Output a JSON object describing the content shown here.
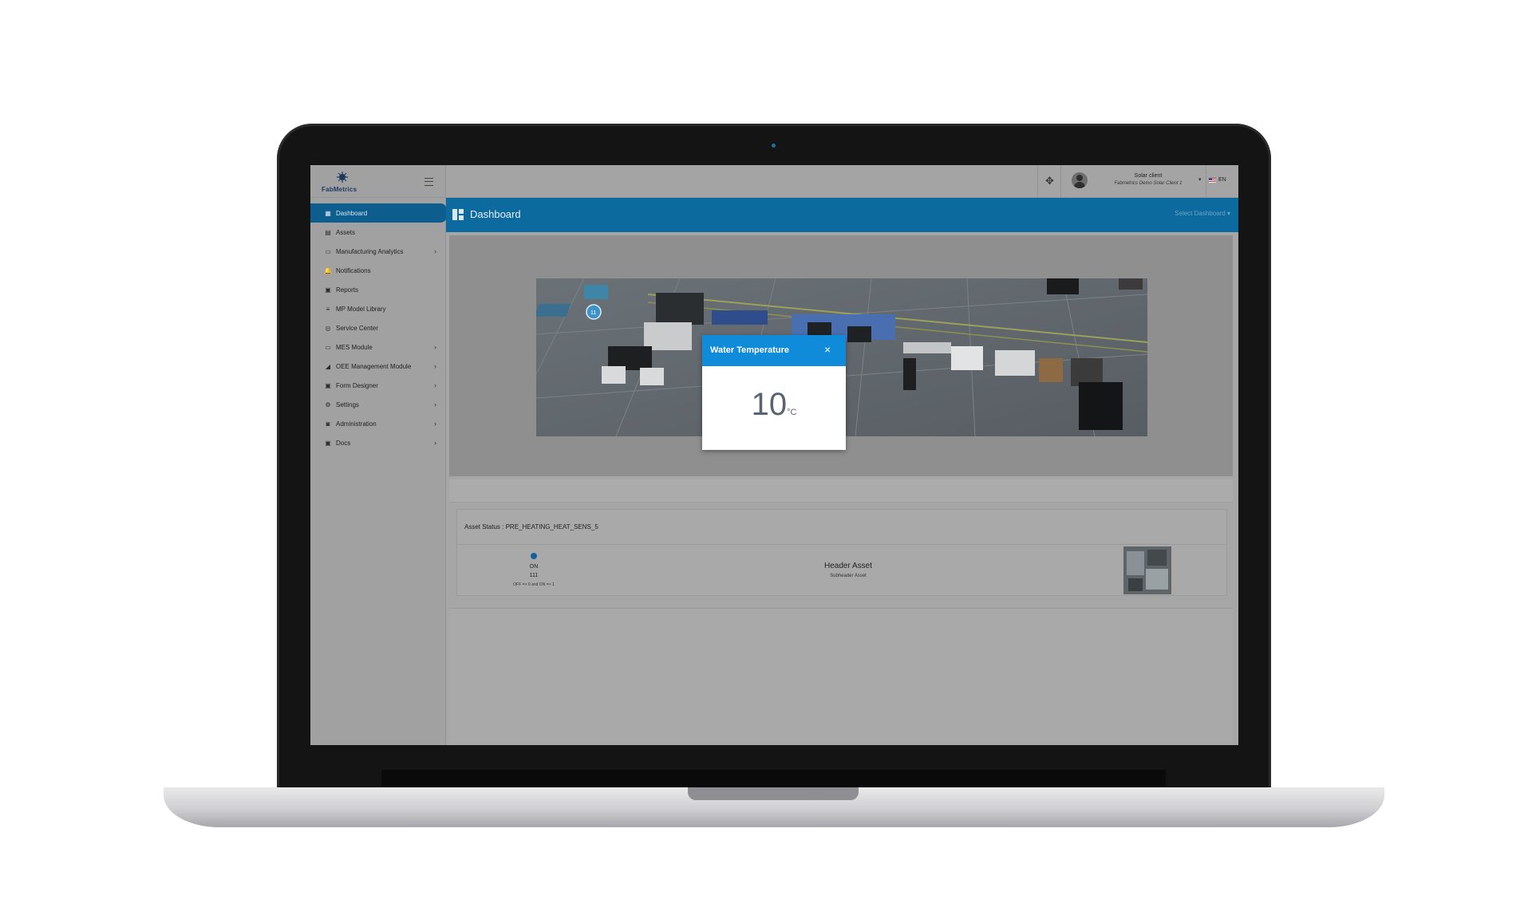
{
  "app": {
    "logo_text": "FabMetrics"
  },
  "sidebar": {
    "items": [
      {
        "label": "Dashboard",
        "icon": "grid-icon",
        "chevron": false,
        "active": true
      },
      {
        "label": "Assets",
        "icon": "box-icon",
        "chevron": false,
        "active": false
      },
      {
        "label": "Manufacturing Analytics",
        "icon": "monitor-icon",
        "chevron": true,
        "active": false
      },
      {
        "label": "Notifications",
        "icon": "bell-icon",
        "chevron": false,
        "active": false
      },
      {
        "label": "Reports",
        "icon": "report-icon",
        "chevron": false,
        "active": false
      },
      {
        "label": "MP Model Library",
        "icon": "list-icon",
        "chevron": false,
        "active": false
      },
      {
        "label": "Service Center",
        "icon": "target-icon",
        "chevron": false,
        "active": false
      },
      {
        "label": "MES Module",
        "icon": "laptop-icon",
        "chevron": true,
        "active": false
      },
      {
        "label": "OEE Management Module",
        "icon": "chart-icon",
        "chevron": true,
        "active": false
      },
      {
        "label": "Form Designer",
        "icon": "form-icon",
        "chevron": true,
        "active": false
      },
      {
        "label": "Settings",
        "icon": "gear-icon",
        "chevron": true,
        "active": false
      },
      {
        "label": "Administration",
        "icon": "admin-icon",
        "chevron": true,
        "active": false
      },
      {
        "label": "Docs",
        "icon": "doc-icon",
        "chevron": true,
        "active": false
      }
    ]
  },
  "topbar": {
    "user_name": "Solar client",
    "user_org": "Fabmetrics Demo Solar Client 1",
    "language": "EN"
  },
  "dashboard": {
    "title": "Dashboard",
    "select_label": "Select Dashboard"
  },
  "modal": {
    "title": "Water Temperature",
    "close": "×",
    "value": "10",
    "unit": "°C"
  },
  "asset_status": {
    "title": "Asset Status : PRE_HEATING_HEAT_SENS_5",
    "status_label": "ON",
    "status_value": "111",
    "status_rule": "OFF => 0 and ON => 1",
    "header": "Header Asset",
    "subheader": "Subheader Asset"
  },
  "colors": {
    "brand_blue": "#0c6a9e",
    "modal_header": "#0f8bd9",
    "status_dot": "#13619a"
  }
}
